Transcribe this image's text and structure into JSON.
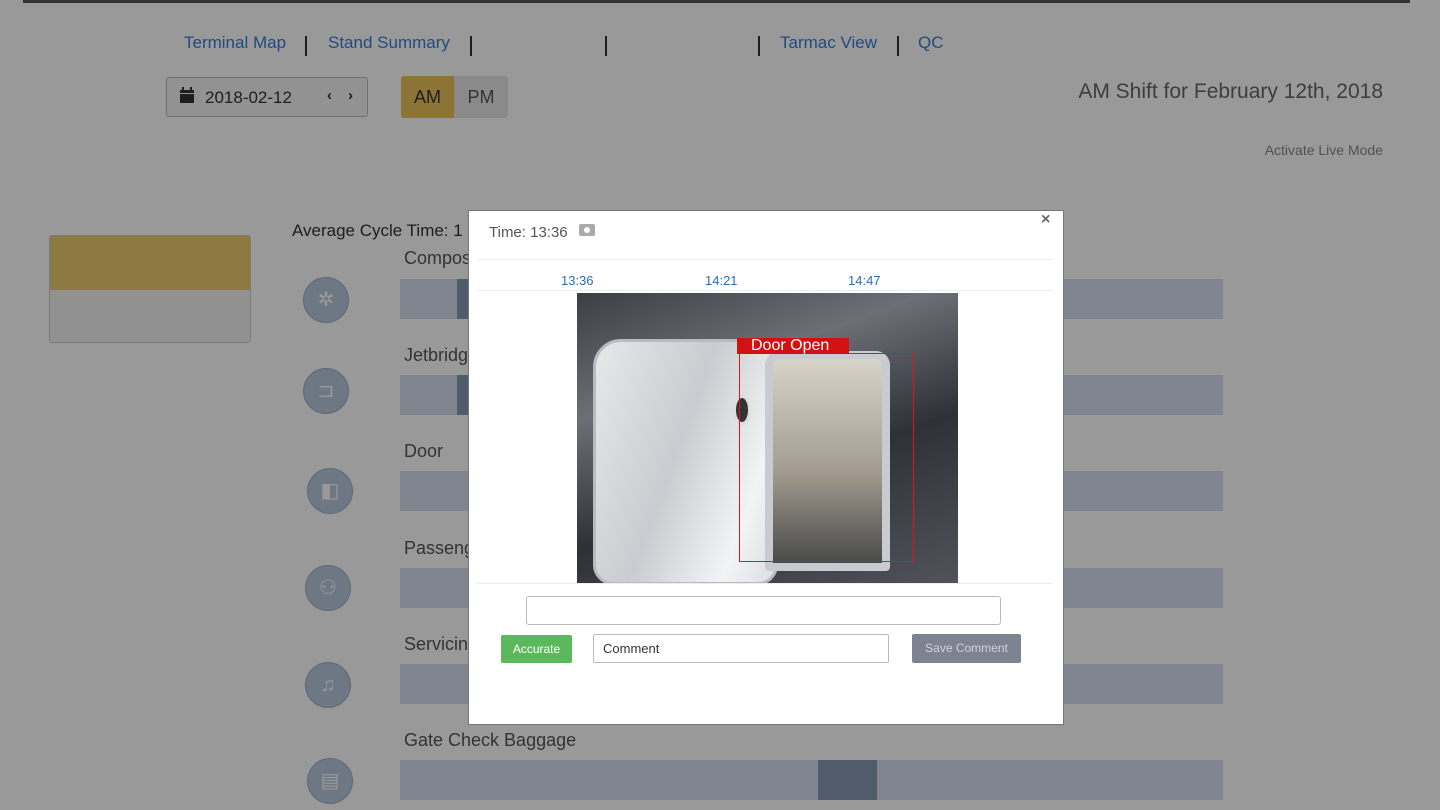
{
  "nav": {
    "items": [
      {
        "label": "Terminal Map"
      },
      {
        "label": "Stand Summary"
      },
      {
        "label": "Tarmac View"
      },
      {
        "label": "QC"
      }
    ]
  },
  "date_picker": {
    "value": "2018-02-12",
    "icon": "calendar-icon",
    "prev": "‹",
    "next": "›"
  },
  "shift_toggle": {
    "am": "AM",
    "pm": "PM",
    "selected": "AM"
  },
  "shift_title": "AM Shift for February 12th, 2018",
  "live_mode_link": "Activate Live Mode",
  "average_cycle_label": "Average Cycle Time: 1",
  "rows": [
    {
      "label": "Compos",
      "icon": "composite-icon"
    },
    {
      "label": "Jetbridg",
      "icon": "jetbridge-icon"
    },
    {
      "label": "Door",
      "icon": "door-icon"
    },
    {
      "label": "Passeng",
      "icon": "passengers-icon"
    },
    {
      "label": "Servicin",
      "icon": "bell-icon"
    },
    {
      "label": "Gate Check Baggage",
      "icon": "baggage-cart-icon"
    }
  ],
  "modal": {
    "time_label": "Time: 13:36",
    "close": "×",
    "timestamps": [
      "13:36",
      "14:21",
      "14:47"
    ],
    "detection_label": "Door Open",
    "accurate_button": "Accurate",
    "comment_placeholder": "Comment",
    "save_button": "Save Comment"
  },
  "colors": {
    "link": "#3a7bd5",
    "am_selected": "#e9c15a",
    "bar_background": "#d7def0",
    "bar_segment": "#8899b2",
    "detection_box": "#e01515",
    "accurate_button": "#5cb85c",
    "save_button": "#7d8390"
  }
}
